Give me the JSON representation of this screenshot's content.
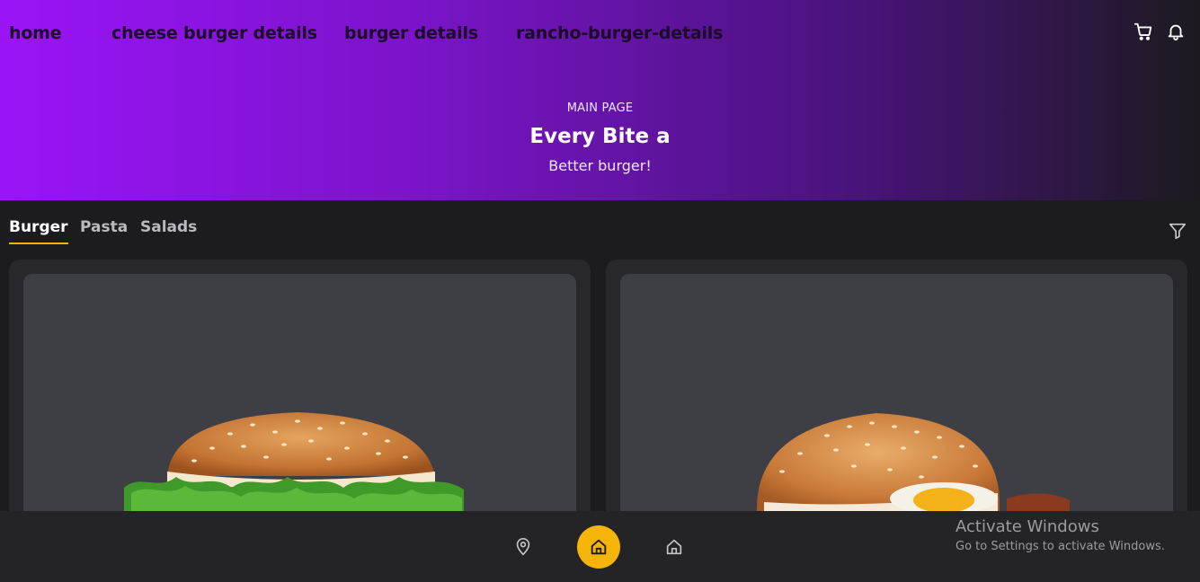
{
  "nav": {
    "links": [
      "home",
      "cheese burger details",
      "burger details",
      "rancho-burger-details"
    ],
    "cart_icon": "cart-icon",
    "bell_icon": "bell-icon"
  },
  "hero": {
    "eyebrow": "MAIN PAGE",
    "title": "Every Bite a",
    "tagline": "Better burger!"
  },
  "tabs": {
    "items": [
      "Burger",
      "Pasta",
      "Salads"
    ],
    "active": "Burger",
    "filter_icon": "filter-icon"
  },
  "cards": [
    {
      "image": "burger-with-lettuce"
    },
    {
      "image": "burger-with-egg"
    }
  ],
  "bottom_nav": {
    "items": [
      "location-icon",
      "home-icon",
      "home-outline-icon"
    ],
    "active_index": 1,
    "accent": "#f4b40a"
  },
  "watermark": {
    "title": "Activate Windows",
    "subtitle": "Go to Settings to activate Windows."
  },
  "colors": {
    "gradient_start": "#9a14f7",
    "gradient_end": "#1c1a1f",
    "background": "#1c1c1f",
    "card": "#28282c",
    "card_image_bg": "#3e3f45"
  }
}
